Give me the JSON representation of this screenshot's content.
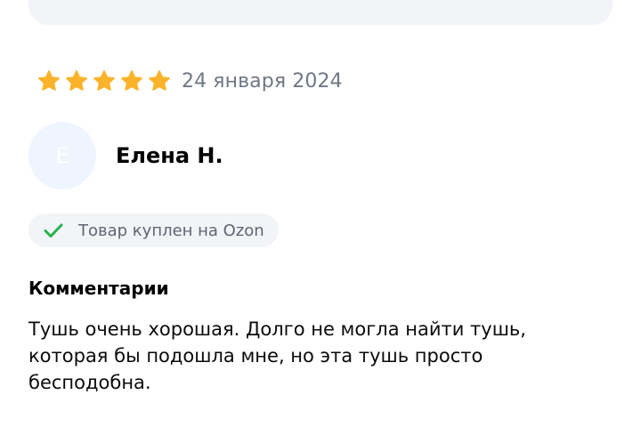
{
  "review": {
    "rating": 5,
    "rating_max": 5,
    "date": "24 января 2024",
    "author": {
      "initial": "Е",
      "name": "Елена Н."
    },
    "purchase_badge": "Товар куплен на Ozon",
    "comment_title": "Комментарии",
    "comment_text": "Тушь очень хорошая. Долго не могла найти тушь, которая бы подошла мне, но эта тушь просто бесподобна."
  },
  "colors": {
    "star": "#fbb32b",
    "check": "#25b34b",
    "muted_text": "#707784",
    "badge_bg": "#f2f4f7",
    "avatar_bg": "#eef5ff"
  },
  "icons": {
    "star": "star-icon",
    "check": "check-icon"
  }
}
